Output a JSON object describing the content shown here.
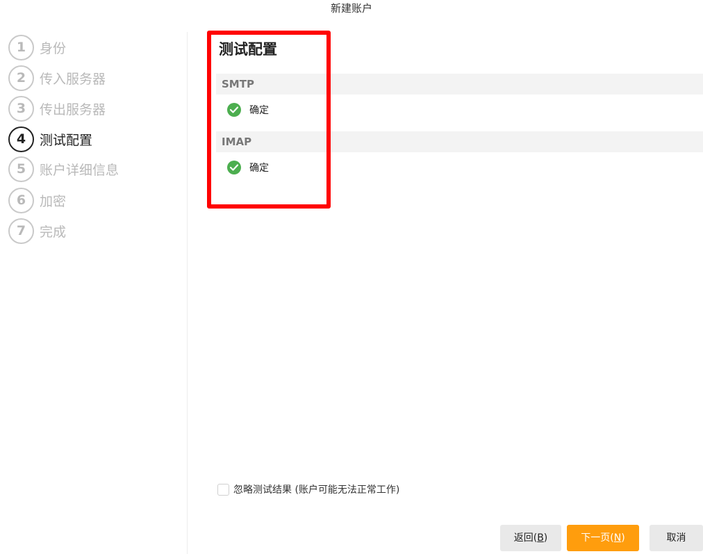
{
  "window": {
    "title": "新建账户"
  },
  "steps": [
    {
      "num": "1",
      "label": "身份"
    },
    {
      "num": "2",
      "label": "传入服务器"
    },
    {
      "num": "3",
      "label": "传出服务器"
    },
    {
      "num": "4",
      "label": "测试配置",
      "active": true
    },
    {
      "num": "5",
      "label": "账户详细信息"
    },
    {
      "num": "6",
      "label": "加密"
    },
    {
      "num": "7",
      "label": "完成"
    }
  ],
  "main": {
    "title": "测试配置",
    "groups": [
      {
        "header": "SMTP",
        "status": "确定",
        "status_icon": "check-circle-icon"
      },
      {
        "header": "IMAP",
        "status": "确定",
        "status_icon": "check-circle-icon"
      }
    ],
    "ignore_checkbox": {
      "label": "忽略测试结果 (账户可能无法正常工作)",
      "checked": false
    }
  },
  "buttons": {
    "back_text": "返回(",
    "back_key": "B",
    "back_close": ")",
    "next_text": "下一页(",
    "next_key": "N",
    "next_close": ")",
    "cancel": "取消"
  },
  "colors": {
    "accent": "#ff9d0d",
    "success": "#4cae4f",
    "highlight": "#ff0000"
  }
}
